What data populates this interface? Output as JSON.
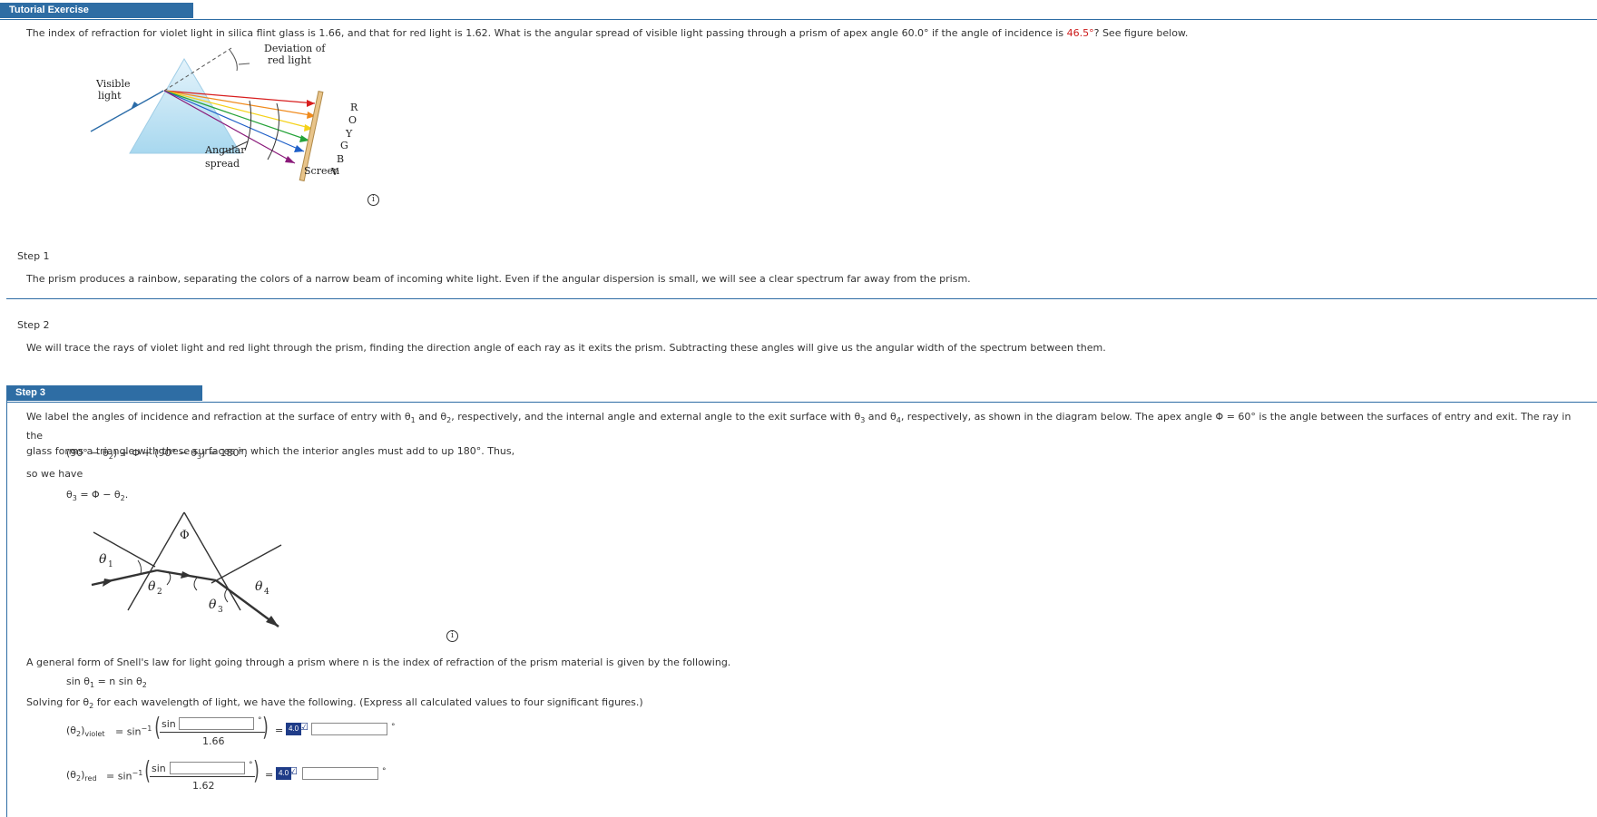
{
  "header": {
    "title": "Tutorial Exercise"
  },
  "problem": {
    "text_before": "The index of refraction for violet light in silica flint glass is 1.66, and that for red light is 1.62. What is the angular spread of visible light passing through a prism of apex angle 60.0° if the angle of incidence is ",
    "incidence_value": "46.5°",
    "text_after": "? See figure below."
  },
  "figure1": {
    "label_visible": "Visible",
    "label_light": "light",
    "label_deviation_1": "Deviation of",
    "label_deviation_2": "red light",
    "label_angular": "Angular",
    "label_spread": "spread",
    "label_screen": "Screen",
    "colors": [
      "R",
      "O",
      "Y",
      "G",
      "B",
      "V"
    ],
    "ray_colors": [
      "#d81e1e",
      "#f08a1c",
      "#f5d21a",
      "#27a33a",
      "#1e5fc8",
      "#8a1a7a"
    ]
  },
  "steps": [
    {
      "label": "Step 1",
      "text": "The prism produces a rainbow, separating the colors of a narrow beam of incoming white light. Even if the angular dispersion is small, we will see a clear spectrum far away from the prism."
    },
    {
      "label": "Step 2",
      "text": "We will trace the rays of violet light and red light through the prism, finding the direction angle of each ray as it exits the prism. Subtracting these angles will give us the angular width of the spectrum between them."
    },
    {
      "label": "Step 3"
    }
  ],
  "step3": {
    "intro_1": "We label the angles of incidence and refraction at the surface of entry with θ",
    "intro_2": " and θ",
    "intro_3": ", respectively, and the internal angle and external angle to the exit surface with θ",
    "intro_4": " and θ",
    "intro_5": ", respectively, as shown in the diagram below. The apex angle Φ = 60° is the angle between the surfaces of entry and exit. The ray in the",
    "intro_line2": "glass forms a triangle with these surfaces in which the interior angles must add to up 180°. Thus,",
    "eq1": "(90° − θ",
    "eq1b": ") + Φ + (90° − θ",
    "eq1c": ") = 180°,",
    "so_we_have": "so we have",
    "eq2": "θ",
    "eq2b": " = Φ − θ",
    "eq2c": ".",
    "snell_intro": "A general form of Snell's law for light going through a prism where n is the index of refraction of the prism material is given by the following.",
    "snell_eq_a": "sin θ",
    "snell_eq_b": " = n sin θ",
    "solving": "Solving for θ",
    "solving_b": " for each wavelength of light, we have the following. (Express all calculated values to four significant figures.)",
    "violet": {
      "lhs": "(θ",
      "sub": "violet",
      "sin_label": "sin",
      "denominator": "1.66",
      "badge": "4.0"
    },
    "red": {
      "lhs": "(θ",
      "sub": "red",
      "sin_label": "sin",
      "denominator": "1.62",
      "badge": "4.0"
    },
    "arcsin": "= sin",
    "arcsin_sup": "−1",
    "equals": "=",
    "degree": "°"
  },
  "figure2": {
    "phi": "Φ",
    "theta": "θ",
    "sub1": "1",
    "sub2": "2",
    "sub3": "3",
    "sub4": "4"
  },
  "subscripts": {
    "one": "1",
    "two": "2",
    "three": "3",
    "four": "4"
  }
}
